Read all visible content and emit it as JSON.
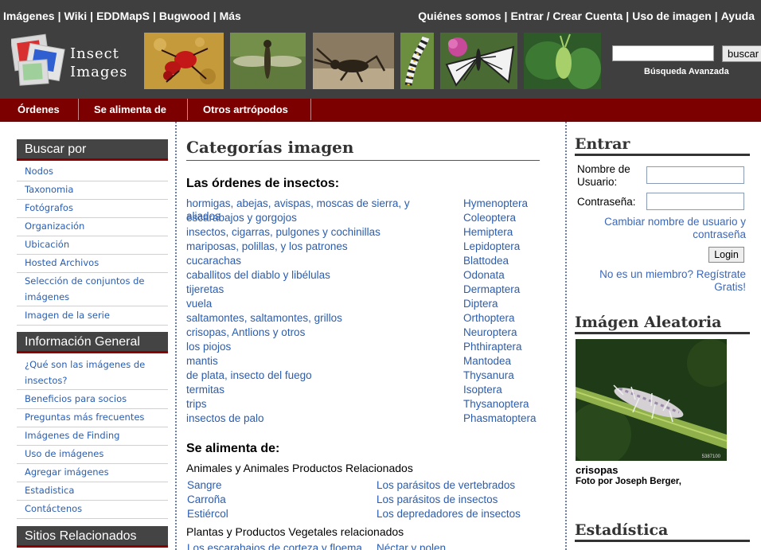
{
  "header": {
    "left_links": [
      "Imágenes",
      "Wiki",
      "EDDMapS",
      "Bugwood",
      "Más"
    ],
    "right_links": [
      "Quiénes somos",
      "Entrar / Crear Cuenta",
      "Uso de imagen",
      "Ayuda"
    ],
    "logo_line1": "Insect",
    "logo_line2": "Images",
    "search_value": "",
    "search_button": "buscar",
    "advanced_search": "Búsqueda Avanzada"
  },
  "nav": {
    "tabs": [
      "Órdenes",
      "Se alimenta de",
      "Otros artrópodos"
    ]
  },
  "sidebar": {
    "search_by": {
      "title": "Buscar por",
      "items": [
        "Nodos",
        "Taxonomia",
        "Fotógrafos",
        "Organización",
        "Ubicación",
        "Hosted Archivos",
        "Selección de conjuntos de imágenes",
        "Imagen de la serie"
      ]
    },
    "general": {
      "title": "Información General",
      "items": [
        "¿Qué son las imágenes de insectos?",
        "Beneficios para socios",
        "Preguntas más frecuentes",
        "Imágenes de Finding",
        "Uso de imágenes",
        "Agregar imágenes",
        "Estadistica",
        "Contáctenos"
      ]
    },
    "related": {
      "title": "Sitios Relacionados"
    }
  },
  "main": {
    "title": "Categorías imagen",
    "orders_heading": "Las órdenes de insectos:",
    "orders": [
      {
        "common": "hormigas, abejas, avispas, moscas de sierra, y aliados",
        "order": "Hymenoptera"
      },
      {
        "common": "escarabajos y gorgojos",
        "order": "Coleoptera"
      },
      {
        "common": "insectos, cigarras, pulgones y cochinillas",
        "order": "Hemiptera"
      },
      {
        "common": "mariposas, polillas, y los patrones",
        "order": "Lepidoptera"
      },
      {
        "common": "cucarachas",
        "order": "Blattodea"
      },
      {
        "common": "caballitos del diablo y libélulas",
        "order": "Odonata"
      },
      {
        "common": "tijeretas",
        "order": "Dermaptera"
      },
      {
        "common": "vuela",
        "order": "Diptera"
      },
      {
        "common": "saltamontes, saltamontes, grillos",
        "order": "Orthoptera"
      },
      {
        "common": "crisopas, Antlions y otros",
        "order": "Neuroptera"
      },
      {
        "common": "los piojos",
        "order": "Phthiraptera"
      },
      {
        "common": "mantis",
        "order": "Mantodea"
      },
      {
        "common": "de plata, insecto del fuego",
        "order": "Thysanura"
      },
      {
        "common": "termitas",
        "order": "Isoptera"
      },
      {
        "common": "trips",
        "order": "Thysanoptera"
      },
      {
        "common": "insectos de palo",
        "order": "Phasmatoptera"
      }
    ],
    "feeds_heading": "Se alimenta de:",
    "animal_heading": "Animales y Animales Productos Relacionados",
    "animal_items": [
      {
        "a": "Sangre",
        "b": "Los parásitos de vertebrados"
      },
      {
        "a": "Carroña",
        "b": "Los parásitos de insectos"
      },
      {
        "a": "Estiércol",
        "b": "Los depredadores de insectos"
      }
    ],
    "plant_heading": "Plantas y Productos Vegetales relacionados",
    "plant_items": [
      {
        "a": "Los escarabajos de corteza y floema",
        "b": "Néctar y polen"
      }
    ]
  },
  "right": {
    "login_title": "Entrar",
    "username_label": "Nombre de Usuario:",
    "password_label": "Contraseña:",
    "username_value": "",
    "password_value": "",
    "change_link": "Cambiar nombre de usuario y contraseña",
    "login_button": "Login",
    "register_link": "No es un miembro? Regístrate Gratis!",
    "random_title": "Imágen Aleatoria",
    "random_caption": "crisopas",
    "random_credit": "Foto por Joseph Berger,",
    "random_id": "5387100",
    "stats_title": "Estadística"
  },
  "colors": {
    "header_bg": "#3f3f3f",
    "nav_bg": "#7d0000",
    "link": "#2a5db0",
    "sidebar_head": "#444444",
    "sidebar_accent": "#8b0000"
  }
}
